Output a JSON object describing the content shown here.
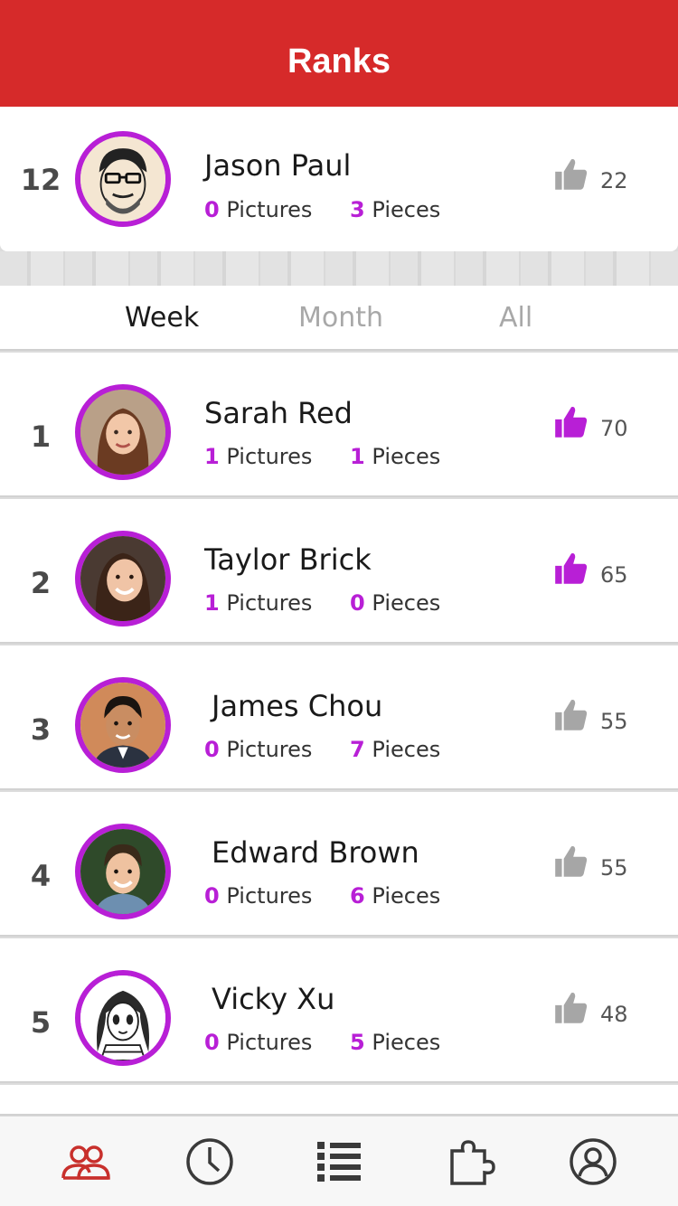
{
  "header": {
    "title": "Ranks"
  },
  "me": {
    "rank": "12",
    "name": "Jason Paul",
    "pictures": "0",
    "pictures_label": "Pictures",
    "pieces": "3",
    "pieces_label": "Pieces",
    "likes": "22",
    "liked": false
  },
  "tabs": [
    {
      "label": "Week",
      "active": true
    },
    {
      "label": "Month",
      "active": false
    },
    {
      "label": "All",
      "active": false
    }
  ],
  "ranks": [
    {
      "rank": "1",
      "name": "Sarah Red",
      "pictures": "1",
      "pictures_label": "Pictures",
      "pieces": "1",
      "pieces_label": "Pieces",
      "likes": "70",
      "liked": true
    },
    {
      "rank": "2",
      "name": "Taylor Brick",
      "pictures": "1",
      "pictures_label": "Pictures",
      "pieces": "0",
      "pieces_label": "Pieces",
      "likes": "65",
      "liked": true
    },
    {
      "rank": "3",
      "name": "James Chou",
      "pictures": "0",
      "pictures_label": "Pictures",
      "pieces": "7",
      "pieces_label": "Pieces",
      "likes": "55",
      "liked": false
    },
    {
      "rank": "4",
      "name": "Edward Brown",
      "pictures": "0",
      "pictures_label": "Pictures",
      "pieces": "6",
      "pieces_label": "Pieces",
      "likes": "55",
      "liked": false
    },
    {
      "rank": "5",
      "name": "Vicky Xu",
      "pictures": "0",
      "pictures_label": "Pictures",
      "pieces": "5",
      "pieces_label": "Pieces",
      "likes": "48",
      "liked": false
    }
  ],
  "tabbar": [
    {
      "icon": "users-icon",
      "active": true
    },
    {
      "icon": "clock-icon",
      "active": false
    },
    {
      "icon": "list-icon",
      "active": false
    },
    {
      "icon": "puzzle-icon",
      "active": false
    },
    {
      "icon": "profile-icon",
      "active": false
    }
  ],
  "colors": {
    "header": "#d62a2a",
    "accent": "#b81fd6",
    "like_inactive": "#a6a6a6",
    "tab_active_icon": "#c8302c",
    "tab_icon": "#3a3a3a"
  }
}
